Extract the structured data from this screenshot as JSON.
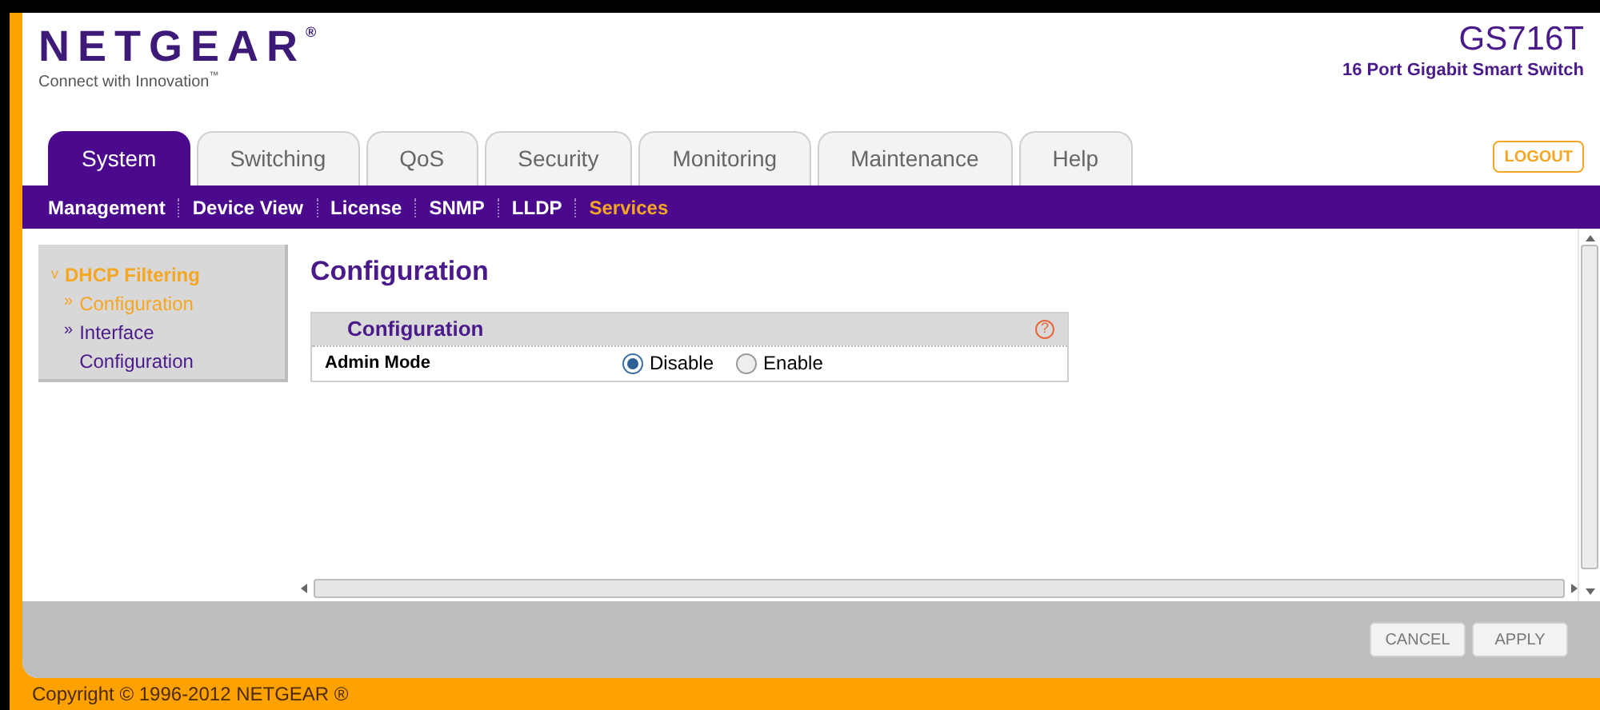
{
  "header": {
    "logo": "NETGEAR",
    "logo_mark": "®",
    "tagline": "Connect with Innovation",
    "tagline_mark": "™",
    "model": "GS716T",
    "model_description": "16 Port Gigabit Smart Switch",
    "logout": "LOGOUT"
  },
  "tabs": [
    {
      "label": "System",
      "selected": true
    },
    {
      "label": "Switching",
      "selected": false
    },
    {
      "label": "QoS",
      "selected": false
    },
    {
      "label": "Security",
      "selected": false
    },
    {
      "label": "Monitoring",
      "selected": false
    },
    {
      "label": "Maintenance",
      "selected": false
    },
    {
      "label": "Help",
      "selected": false
    }
  ],
  "subnav": [
    {
      "label": "Management",
      "selected": false
    },
    {
      "label": "Device View",
      "selected": false
    },
    {
      "label": "License",
      "selected": false
    },
    {
      "label": "SNMP",
      "selected": false
    },
    {
      "label": "LLDP",
      "selected": false
    },
    {
      "label": "Services",
      "selected": true
    }
  ],
  "sidebar": {
    "section": "DHCP Filtering",
    "section_icon": "v",
    "expanded": true,
    "items": [
      {
        "bullet": "»",
        "label": "Configuration",
        "selected": true
      },
      {
        "bullet": "»",
        "label": "Interface Configuration",
        "selected": false
      }
    ]
  },
  "page_title": "Configuration",
  "panel": {
    "title": "Configuration",
    "help": "?",
    "rows": [
      {
        "label": "Admin Mode",
        "options": [
          {
            "label": "Disable",
            "selected": true
          },
          {
            "label": "Enable",
            "selected": false
          }
        ]
      }
    ]
  },
  "buttons": [
    "CANCEL",
    "APPLY"
  ],
  "footer": "Copyright © 1996-2012 NETGEAR ®"
}
